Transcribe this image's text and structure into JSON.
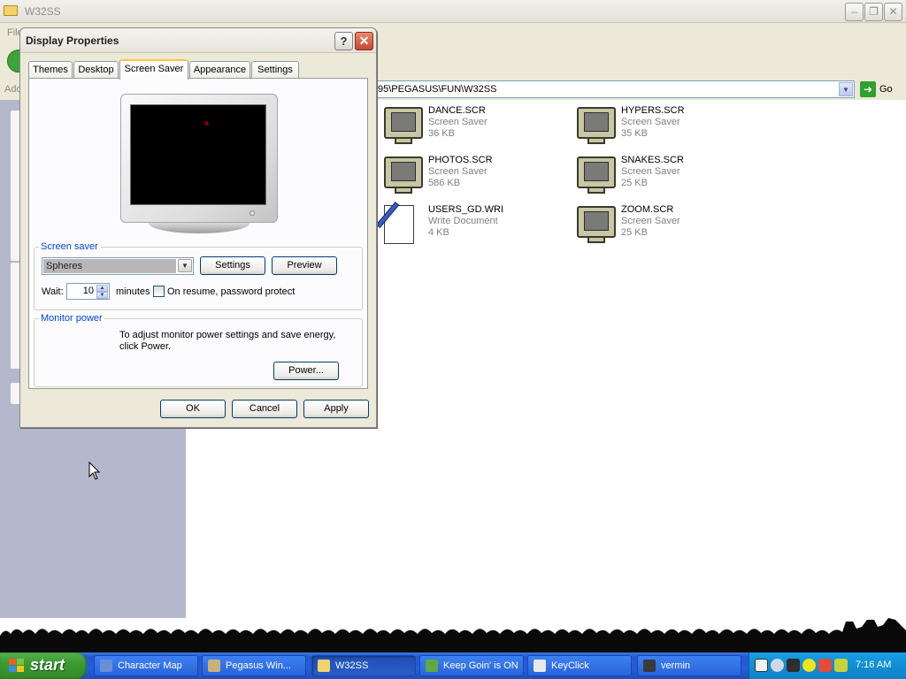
{
  "explorer": {
    "title": "W32SS",
    "menu_text": "File",
    "address_label": "Address",
    "address_value": "95\\PEGASUS\\FUN\\W32SS",
    "go_label": "Go",
    "files": [
      {
        "name": "DANCE.SCR",
        "type": "Screen Saver",
        "size": "36 KB",
        "icon": "monitor-icon"
      },
      {
        "name": "HYPERS.SCR",
        "type": "Screen Saver",
        "size": "35 KB",
        "icon": "monitor-icon"
      },
      {
        "name": "PHOTOS.SCR",
        "type": "Screen Saver",
        "size": "586 KB",
        "icon": "monitor-icon"
      },
      {
        "name": "SNAKES.SCR",
        "type": "Screen Saver",
        "size": "25 KB",
        "icon": "monitor-icon"
      },
      {
        "name": "USERS_GD.WRI",
        "type": "Write Document",
        "size": "4 KB",
        "icon": "write-document-icon"
      },
      {
        "name": "ZOOM.SCR",
        "type": "Screen Saver",
        "size": "25 KB",
        "icon": "monitor-icon"
      }
    ]
  },
  "dialog": {
    "title": "Display Properties",
    "help_label": "?",
    "close_label": "✕",
    "tabs": [
      {
        "label": "Themes"
      },
      {
        "label": "Desktop"
      },
      {
        "label": "Screen Saver",
        "active": true
      },
      {
        "label": "Appearance"
      },
      {
        "label": "Settings"
      }
    ],
    "screen_saver": {
      "group_label": "Screen saver",
      "selected": "Spheres",
      "settings_label": "Settings",
      "preview_label": "Preview",
      "wait_label": "Wait:",
      "wait_value": "10",
      "minutes_label": "minutes",
      "password_label": "On resume, password protect",
      "password_checked": false
    },
    "monitor_power": {
      "group_label": "Monitor power",
      "text_line1": "To adjust monitor power settings and save energy,",
      "text_line2": "click Power.",
      "power_label": "Power..."
    },
    "ok_label": "OK",
    "cancel_label": "Cancel",
    "apply_label": "Apply"
  },
  "taskbar": {
    "start_label": "start",
    "tasks": [
      {
        "label": "Character Map",
        "color": "#6B8FD6"
      },
      {
        "label": "Pegasus Win...",
        "color": "#C9B27A"
      },
      {
        "label": "W32SS",
        "color": "#F2D36B",
        "active": true
      },
      {
        "label": "Keep Goin' is ON",
        "color": "#5FA844"
      },
      {
        "label": "KeyClick",
        "color": "#E8E8E8"
      },
      {
        "label": "vermin",
        "color": "#3A3A3A"
      }
    ],
    "clock": "7:16 AM"
  },
  "colors": {
    "taskbar_blue": "#245ED9",
    "start_green": "#3B9B33",
    "tray_blue": "#1290D6",
    "group_label_blue": "#0046D5",
    "active_tab_orange": "#FFC83C"
  }
}
